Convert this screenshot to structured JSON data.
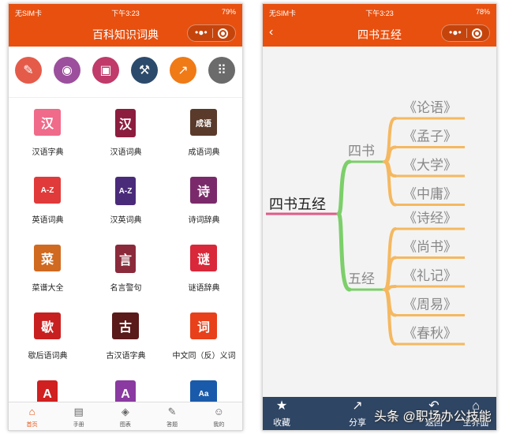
{
  "left_phone": {
    "status": {
      "carrier": "无SIM卡",
      "wifi_icon": "wifi-icon",
      "time": "下午3:23",
      "battery": "79%"
    },
    "title": "百科知识词典",
    "tools": [
      {
        "icon": "edit-icon",
        "color": "#e55b4a"
      },
      {
        "icon": "user-profile-icon",
        "color": "#9c4f9c"
      },
      {
        "icon": "image-icon",
        "color": "#c03a6a"
      },
      {
        "icon": "tools-icon",
        "color": "#2c4a6b"
      },
      {
        "icon": "share-icon",
        "color": "#f07a16"
      },
      {
        "icon": "apps-grid-icon",
        "color": "#6b6b6b"
      }
    ],
    "books": [
      {
        "label": "汉语字典",
        "glyph": "汉",
        "color": "#f06a8a"
      },
      {
        "label": "汉语词典",
        "glyph": "汉",
        "color": "#8c1d3e"
      },
      {
        "label": "成语词典",
        "glyph": "成语",
        "color": "#5a3a2a"
      },
      {
        "label": "英语词典",
        "glyph": "A-Z",
        "color": "#e03a3a"
      },
      {
        "label": "汉英词典",
        "glyph": "A-Z",
        "color": "#4a2b7a"
      },
      {
        "label": "诗词辞典",
        "glyph": "诗",
        "color": "#7a2a6a"
      },
      {
        "label": "菜谱大全",
        "glyph": "菜",
        "color": "#d06a20"
      },
      {
        "label": "名言警句",
        "glyph": "言",
        "color": "#8a2a3a"
      },
      {
        "label": "谜语辞典",
        "glyph": "谜",
        "color": "#d8283a"
      },
      {
        "label": "歇后语词典",
        "glyph": "歇",
        "color": "#c82020"
      },
      {
        "label": "古汉语字典",
        "glyph": "古",
        "color": "#5a1a1a"
      },
      {
        "label": "中文同（反）义词",
        "glyph": "词",
        "color": "#e8401a"
      },
      {
        "label": "",
        "glyph": "A",
        "color": "#d02020"
      },
      {
        "label": "",
        "glyph": "A",
        "color": "#8a3aa0"
      },
      {
        "label": "",
        "glyph": "Aa",
        "color": "#1a5aaa"
      }
    ],
    "tabs": [
      {
        "label": "首页",
        "icon": "home-icon",
        "active": true
      },
      {
        "label": "手册",
        "icon": "manual-icon",
        "active": false
      },
      {
        "label": "图表",
        "icon": "layers-icon",
        "active": false
      },
      {
        "label": "答题",
        "icon": "quiz-icon",
        "active": false
      },
      {
        "label": "我的",
        "icon": "person-icon",
        "active": false
      }
    ]
  },
  "right_phone": {
    "status": {
      "carrier": "无SIM卡",
      "wifi_icon": "wifi-icon",
      "time": "下午3:23",
      "battery": "78%"
    },
    "title": "四书五经",
    "mindmap": {
      "root": "四书五经",
      "branches": [
        {
          "label": "四书",
          "children": [
            "《论语》",
            "《孟子》",
            "《大学》",
            "《中庸》"
          ]
        },
        {
          "label": "五经",
          "children": [
            "《诗经》",
            "《尚书》",
            "《礼记》",
            "《周易》",
            "《春秋》"
          ]
        }
      ],
      "colors": {
        "root_line": "#e05a8a",
        "branch_line": "#7ccf6a",
        "leaf_line": "#f5b860",
        "text": "#888888",
        "root_text": "#222222"
      }
    },
    "bottom_bar": [
      {
        "label": "收藏",
        "icon": "star-icon"
      },
      {
        "label": "分享",
        "icon": "share-icon"
      },
      {
        "label": "返回",
        "icon": "back-arrow-icon"
      },
      {
        "label": "主界面",
        "icon": "home-icon"
      }
    ]
  },
  "watermark": "头条 @职场办公技能"
}
